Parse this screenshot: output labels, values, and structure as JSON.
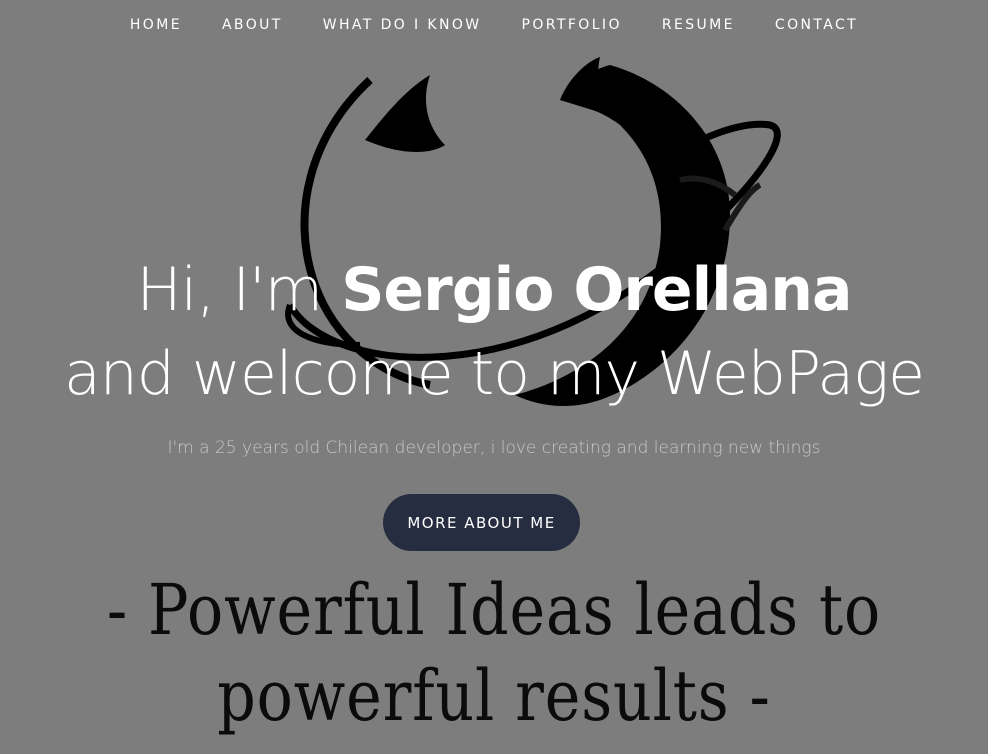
{
  "nav": {
    "items": [
      {
        "label": "HOME"
      },
      {
        "label": "ABOUT"
      },
      {
        "label": "WHAT DO I KNOW"
      },
      {
        "label": "PORTFOLIO"
      },
      {
        "label": "RESUME"
      },
      {
        "label": "CONTACT"
      }
    ]
  },
  "hero": {
    "greeting_prefix": "Hi, I'm",
    "name": "Sergio Orellana",
    "line2": "and welcome to my WebPage",
    "subtitle": "I'm a 25 years old Chilean developer, i love creating and learning new things",
    "cta_label": "MORE ABOUT ME"
  },
  "quote": {
    "line1": "- Powerful Ideas leads to",
    "line2": "powerful results -"
  },
  "colors": {
    "background": "#7d7d7d",
    "cta_background": "#262d40",
    "quote_text": "#0b0b0b"
  },
  "logo": {
    "icon": "planet-ring-logo-icon"
  }
}
